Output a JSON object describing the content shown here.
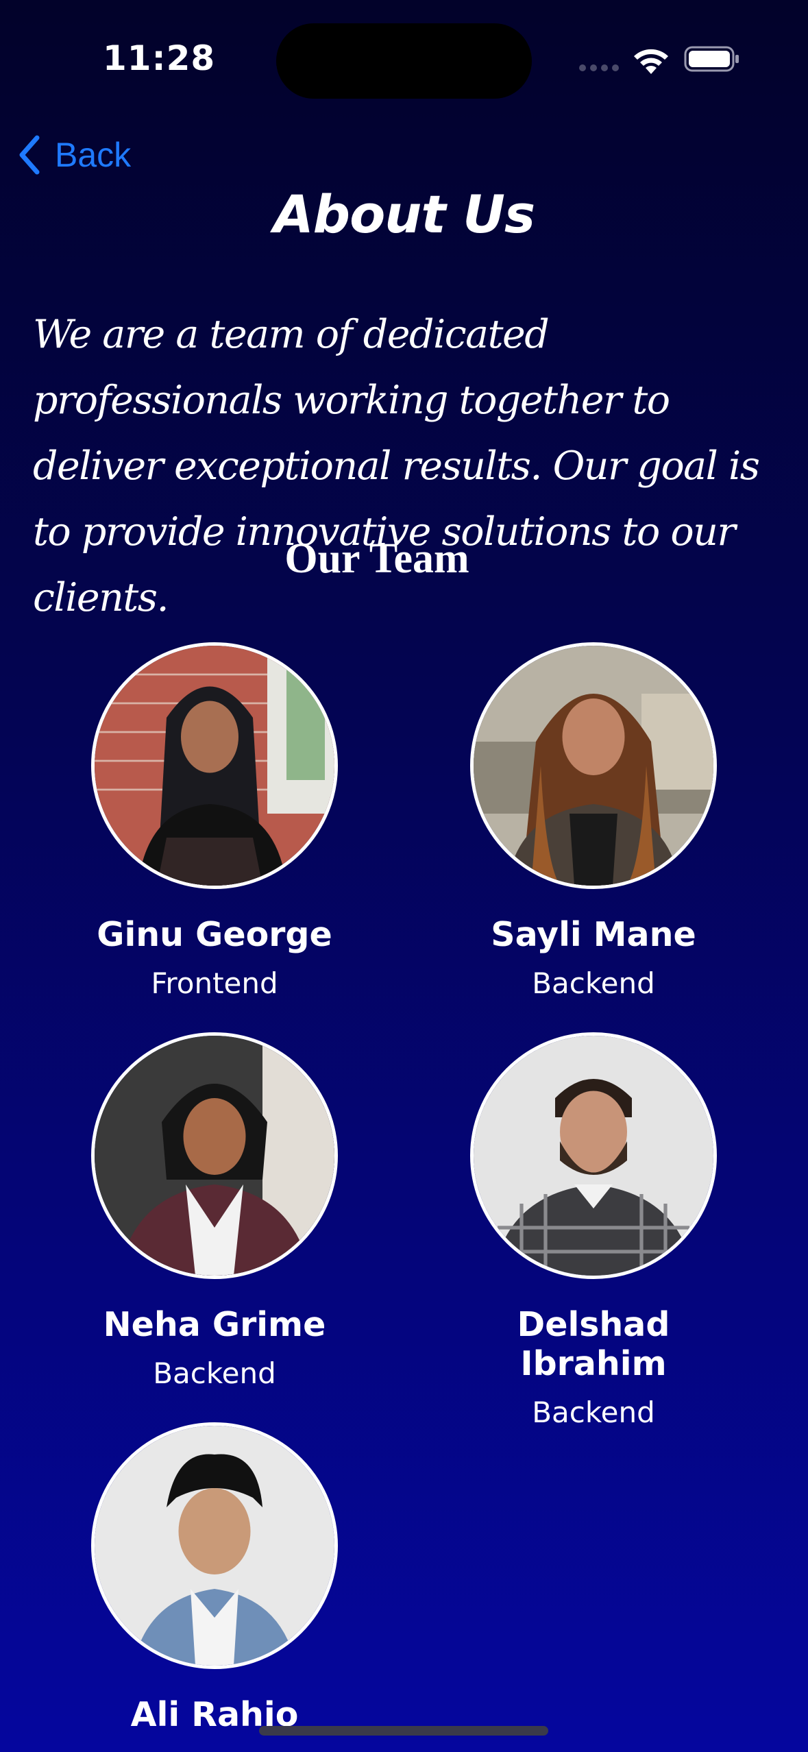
{
  "status_bar": {
    "time": "11:28",
    "icons": [
      "cellular-signal-icon",
      "wifi-icon",
      "battery-icon"
    ]
  },
  "nav": {
    "back_label": "Back",
    "back_icon": "chevron-left-icon",
    "accent_color": "#1f7aff"
  },
  "page": {
    "title": "About Us",
    "intro": "We are a team of dedicated professionals working together to deliver exceptional results. Our goal is to provide innovative solutions to our clients.",
    "team_heading": "Our Team"
  },
  "team": [
    {
      "name": "Ginu George",
      "role": "Frontend"
    },
    {
      "name": "Sayli Mane",
      "role": "Backend"
    },
    {
      "name": "Neha Grime",
      "role": "Backend"
    },
    {
      "name": "Delshad Ibrahim",
      "role": "Backend"
    },
    {
      "name": "Ali Rahjo",
      "role": ""
    }
  ],
  "colors": {
    "background_top": "#02022a",
    "background_bottom": "#05069e",
    "text": "#ffffff"
  }
}
